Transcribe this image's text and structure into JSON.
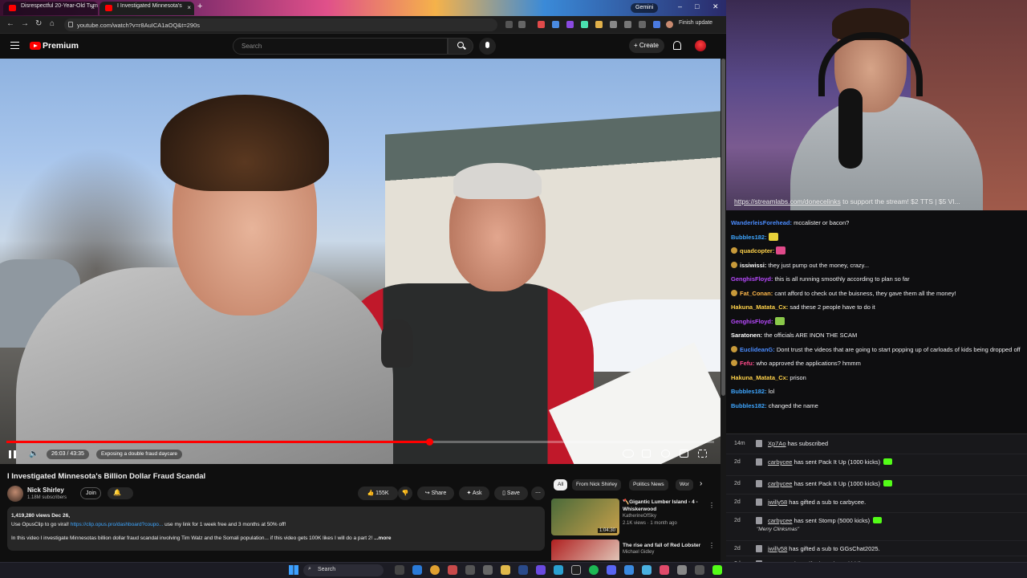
{
  "browser": {
    "tabs": [
      {
        "label": "Disrespectful 20-Year-Old Turn"
      },
      {
        "label": "I Investigated Minnesota's"
      }
    ],
    "gemini_label": "Gemini",
    "url": "youtube.com/watch?v=r8AuICA1aOQ&t=290s",
    "finish_update": "Finish update"
  },
  "yt_header": {
    "brand": "Premium",
    "search_placeholder": "Search",
    "create_label": "Create"
  },
  "player": {
    "time": "26:03 / 43:35",
    "chapter": "Exposing a double fraud daycare",
    "progress": 0.598
  },
  "video_info": {
    "title": "I Investigated Minnesota's Billion Dollar Fraud Scandal",
    "channel": "Nick Shirley",
    "subscribers": "1.18M subscribers",
    "join_label": "Join",
    "likes": "155K",
    "share_label": "Share",
    "ask_label": "Ask",
    "save_label": "Save",
    "views_date": "1,419,280 views  Dec 26,",
    "desc_line1": "Use OpusClip to go viral!",
    "desc_link": "https://clip.opus.pro/dashboard?coupo...",
    "desc_line1_tail": "use my link for 1 week free and 3 months at 50% off!",
    "desc_line2": "In this video I investigate Minnesotas billion dollar fraud scandal involving Tim Walz and the Somali population... if this video gets 100K likes I will do a part 2!",
    "more_label": "...more"
  },
  "chips": [
    "All",
    "From Nick Shirley",
    "Politics News",
    "Wor"
  ],
  "recommendations": [
    {
      "title": "🪓Gigantic Lumber Island - 4 - Whiskerwood",
      "channel": "KatherineOfSky",
      "meta": "2.1K views · 1 month ago",
      "duration": "1:04:30",
      "thumb_color": "#4a6a3a"
    },
    {
      "title": "The rise and fall of Red Lobster",
      "channel": "Michael Gidley",
      "meta": "",
      "duration": "",
      "thumb_color": "#b02020"
    }
  ],
  "webcam": {
    "banner_link": "https://streamlabs.com/donecelinks",
    "banner_text": "to support the stream! $2 TTS | $5 VI..."
  },
  "chat": [
    {
      "user": "WanderleisForehead:",
      "color": "#4a8cff",
      "text": "mccalister or bacon?",
      "badge": false,
      "emote": ""
    },
    {
      "user": "Bubbles182:",
      "color": "#3ea6ff",
      "text": "",
      "badge": false,
      "emote": "#e8d23a"
    },
    {
      "user": "quadcopter:",
      "color": "#ffd24a",
      "text": "",
      "badge": true,
      "emote": "#e04a8a"
    },
    {
      "user": "issiwissi:",
      "color": "#ffffff",
      "text": "they just pump out the money, crazy...",
      "badge": true,
      "emote": ""
    },
    {
      "user": "GenghisFloyd:",
      "color": "#b94aff",
      "text": "this is all running smoothly according to plan so far",
      "badge": false,
      "emote": ""
    },
    {
      "user": "Fat_Conan:",
      "color": "#ffb84a",
      "text": "cant afford to check out the buisness, they gave them all the money!",
      "badge": true,
      "emote": ""
    },
    {
      "user": "Hakuna_Matata_Cx:",
      "color": "#ffd24a",
      "text": "sad these 2 people have to do it",
      "badge": false,
      "emote": ""
    },
    {
      "user": "GenghisFloyd:",
      "color": "#b94aff",
      "text": "",
      "badge": false,
      "emote": "#8ac84a"
    },
    {
      "user": "Saratonen:",
      "color": "#ffffff",
      "text": "the officials ARE INON THE SCAM",
      "badge": false,
      "emote": ""
    },
    {
      "user": "EuclideanG:",
      "color": "#4a8cff",
      "text": "Dont trust the videos that are going to start popping up of carloads of kids being dropped off",
      "badge": true,
      "emote": ""
    },
    {
      "user": "Fefu:",
      "color": "#ff4a8a",
      "text": "who approved the applications? hmmm",
      "badge": true,
      "emote": ""
    },
    {
      "user": "Hakuna_Matata_Cx:",
      "color": "#ffd24a",
      "text": "prison",
      "badge": false,
      "emote": ""
    },
    {
      "user": "Bubbles182:",
      "color": "#3ea6ff",
      "text": "lol",
      "badge": false,
      "emote": ""
    },
    {
      "user": "Bubbles182:",
      "color": "#3ea6ff",
      "text": "changed the name",
      "badge": false,
      "emote": ""
    }
  ],
  "events": [
    {
      "time": "14m",
      "name": "Xp7Ao",
      "text": "has subscribed",
      "gem": false,
      "sub": ""
    },
    {
      "time": "2d",
      "name": "carbycee",
      "text": "has sent Pack It Up (1000 kicks)",
      "gem": true,
      "sub": ""
    },
    {
      "time": "2d",
      "name": "carbycee",
      "text": "has sent Pack It Up (1000 kicks)",
      "gem": true,
      "sub": ""
    },
    {
      "time": "2d",
      "name": "jwilly58",
      "text": "has gifted a sub to carbycee.",
      "gem": false,
      "sub": ""
    },
    {
      "time": "2d",
      "name": "carbycee",
      "text": "has sent Stomp (5000 kicks)",
      "gem": true,
      "sub": "\"Merry Clinksmas\""
    },
    {
      "time": "2d",
      "name": "jwilly58",
      "text": "has gifted a sub to GGsChat2025.",
      "gem": false,
      "sub": ""
    },
    {
      "time": "2d",
      "name": "remmacs",
      "text": "has gifted a sub to skiddlynoot.",
      "gem": false,
      "sub": ""
    }
  ],
  "taskbar": {
    "search_label": "Search"
  }
}
